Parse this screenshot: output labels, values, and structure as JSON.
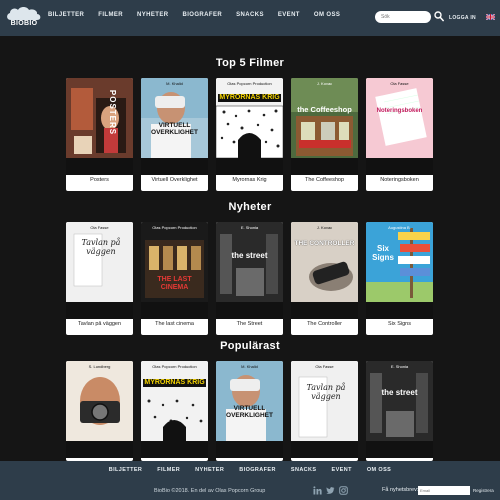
{
  "header": {
    "logo_text": "BIOBIO",
    "nav": [
      "BILJETTER",
      "FILMER",
      "NYHETER",
      "BIOGRAFER",
      "SNACKS",
      "EVENT",
      "OM OSS"
    ],
    "search_placeholder": "Sök",
    "login": "LOGGA IN"
  },
  "sections": [
    {
      "title": "Top 5 Filmer",
      "movies": [
        {
          "title": "Posters",
          "poster_text": "POSTERS",
          "credit": "S. Lundberg"
        },
        {
          "title": "Virtuell Overklighet",
          "poster_text": "VIRTUELL OVERKLIGHET",
          "credit": "M. Khalid"
        },
        {
          "title": "Myrornas Krig",
          "poster_text": "MYRORNAS KRIG",
          "credit": "Olas Popcorn Production"
        },
        {
          "title": "The Coffeeshop",
          "poster_text": "the Coffeeshop",
          "credit": "J. Kovac"
        },
        {
          "title": "Noteringsboken",
          "poster_text": "Noteringsboken",
          "credit": "Ola Fasse"
        }
      ]
    },
    {
      "title": "Nyheter",
      "movies": [
        {
          "title": "Tavlan på väggen",
          "poster_text": "Tavlan på väggen",
          "credit": "Ola Fasse"
        },
        {
          "title": "The last cinema",
          "poster_text": "THE LAST CINEMA",
          "credit": "Olas Popcorn Production"
        },
        {
          "title": "The Street",
          "poster_text": "the street",
          "credit": "E. Shonia"
        },
        {
          "title": "The Controller",
          "poster_text": "THE CONTROLLER",
          "credit": "J. Kovac"
        },
        {
          "title": "Six Signs",
          "poster_text": "Six Signs",
          "credit": "Augustina B."
        }
      ]
    },
    {
      "title": "Populärast",
      "movies": [
        {
          "title": "",
          "poster_text": "",
          "credit": "S. Lundberg"
        },
        {
          "title": "",
          "poster_text": "MYRORNAS KRIG",
          "credit": "Olas Popcorn Production"
        },
        {
          "title": "",
          "poster_text": "VIRTUELL OVERKLIGHET",
          "credit": "M. Khalid"
        },
        {
          "title": "",
          "poster_text": "Tavlan på väggen",
          "credit": "Ola Fasse"
        },
        {
          "title": "",
          "poster_text": "the street",
          "credit": "E. Shonia"
        }
      ]
    }
  ],
  "footer": {
    "nav": [
      "BILJETTER",
      "FILMER",
      "NYHETER",
      "BIOGRAFER",
      "SNACKS",
      "EVENT",
      "OM OSS"
    ],
    "copyright": "BioBio ©2018. En del av Olas Popcorn Group",
    "newsletter_label": "Få nyhetsbrev:",
    "newsletter_placeholder": "Email",
    "register": "Registrera"
  },
  "colors": {
    "header_bg": "#2e3d4a",
    "page_bg": "#151515",
    "card_bg": "#ffffff"
  }
}
